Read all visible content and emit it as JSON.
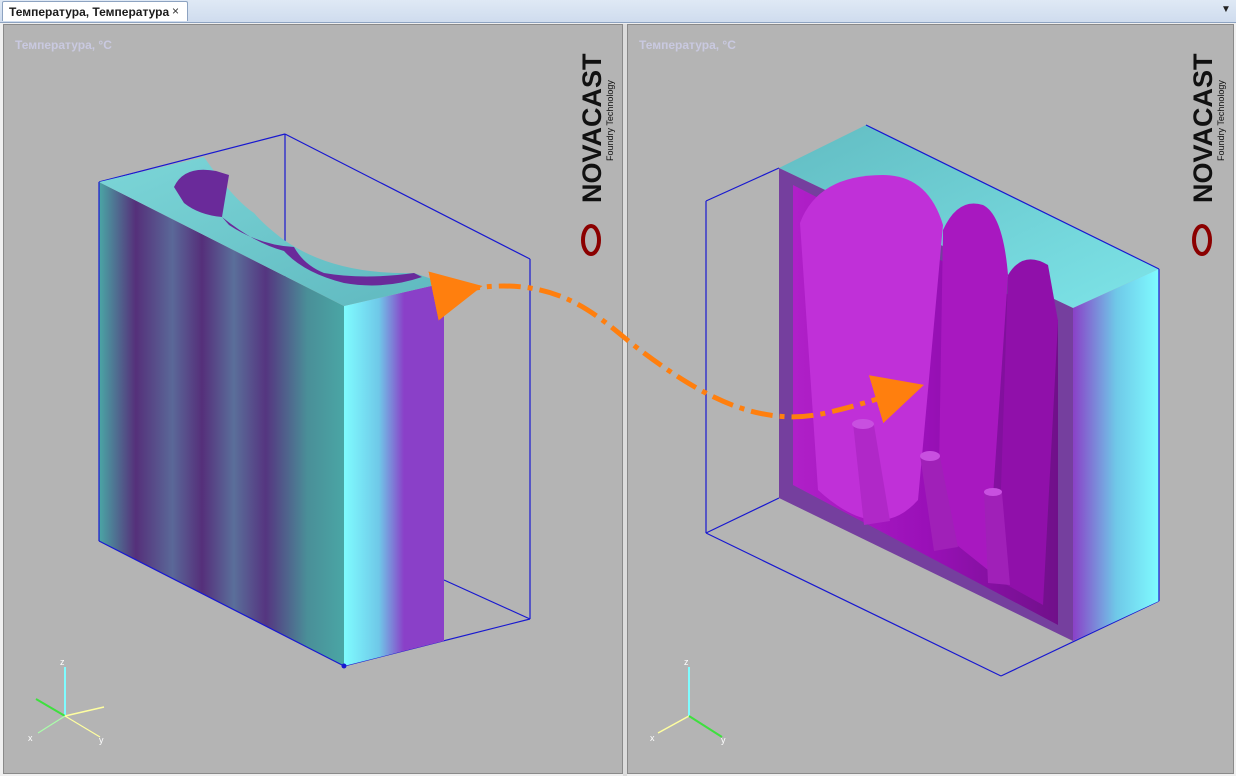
{
  "tab": {
    "label": "Температура, Температура",
    "close": "×"
  },
  "tab_menu": "▼",
  "viewports": [
    {
      "title": "Температура, °C",
      "logo_text": "NOVACAST",
      "logo_sub": "Foundry Technology"
    },
    {
      "title": "Температура, °C",
      "logo_text": "NOVACAST",
      "logo_sub": "Foundry Technology"
    }
  ],
  "axes": {
    "z": "z",
    "x": "x",
    "y": "y"
  },
  "colors": {
    "viewport_bg": "#b4b4b4",
    "bbox": "#1818d0",
    "arrow": "#ff7f0e",
    "cyan": "#7ffcff",
    "magenta": "#9a10b8",
    "logo_red": "#8b0000"
  }
}
